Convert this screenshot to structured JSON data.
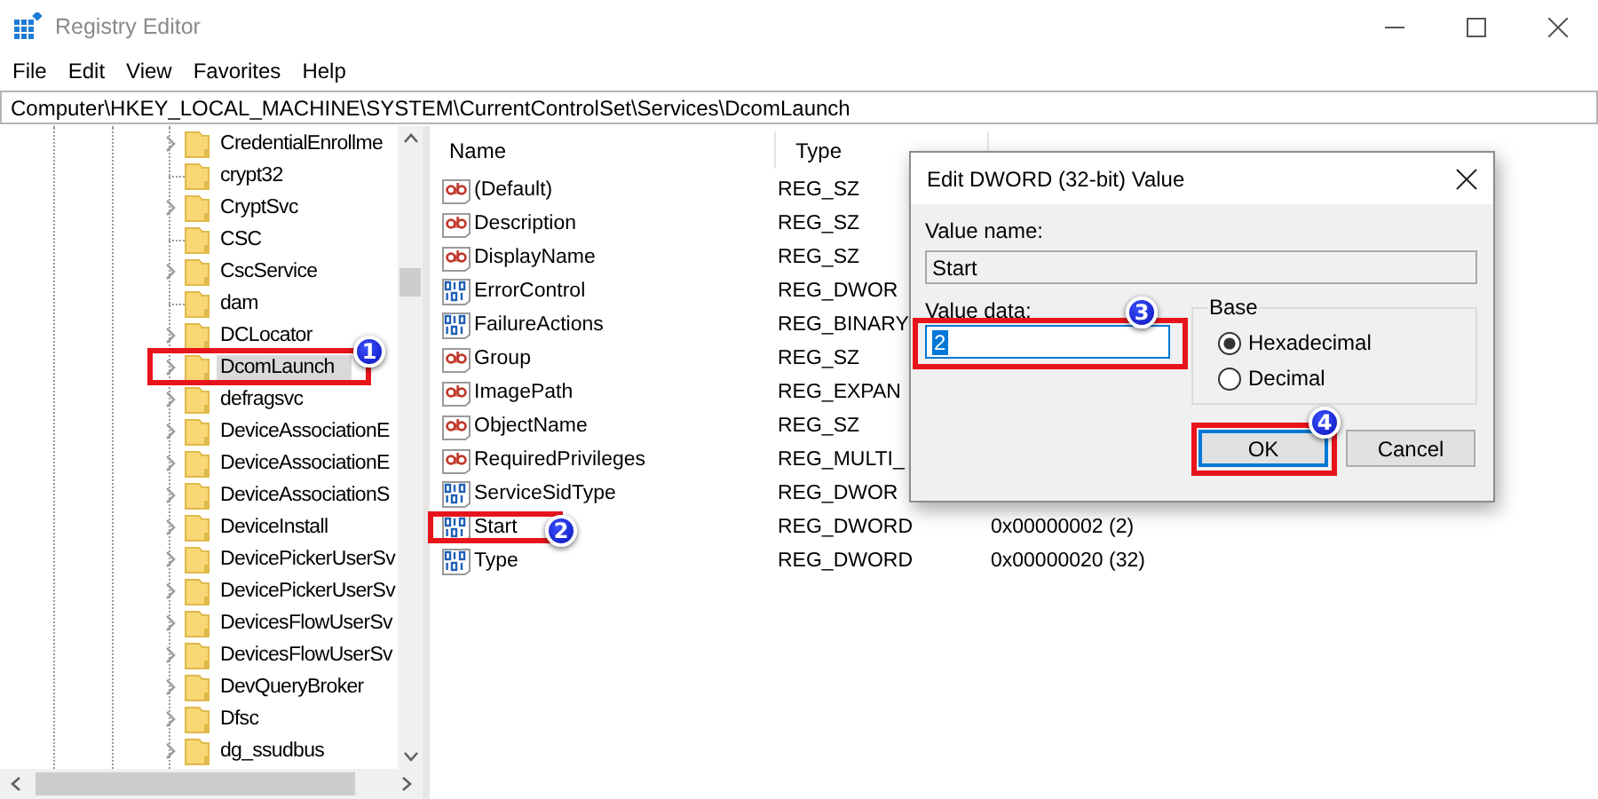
{
  "window": {
    "title": "Registry Editor"
  },
  "menu": [
    {
      "label": "File"
    },
    {
      "label": "Edit"
    },
    {
      "label": "View"
    },
    {
      "label": "Favorites"
    },
    {
      "label": "Help"
    }
  ],
  "address": "Computer\\HKEY_LOCAL_MACHINE\\SYSTEM\\CurrentControlSet\\Services\\DcomLaunch",
  "tree": {
    "items": [
      {
        "label": "CredentialEnrollme",
        "expandable": true,
        "selected": false
      },
      {
        "label": "crypt32",
        "expandable": false,
        "selected": false
      },
      {
        "label": "CryptSvc",
        "expandable": true,
        "selected": false
      },
      {
        "label": "CSC",
        "expandable": false,
        "selected": false
      },
      {
        "label": "CscService",
        "expandable": true,
        "selected": false
      },
      {
        "label": "dam",
        "expandable": false,
        "selected": false
      },
      {
        "label": "DCLocator",
        "expandable": true,
        "selected": false
      },
      {
        "label": "DcomLaunch",
        "expandable": true,
        "selected": true,
        "callout": "1"
      },
      {
        "label": "defragsvc",
        "expandable": true,
        "selected": false
      },
      {
        "label": "DeviceAssociationE",
        "expandable": true,
        "selected": false
      },
      {
        "label": "DeviceAssociationE",
        "expandable": true,
        "selected": false
      },
      {
        "label": "DeviceAssociationS",
        "expandable": true,
        "selected": false
      },
      {
        "label": "DeviceInstall",
        "expandable": true,
        "selected": false
      },
      {
        "label": "DevicePickerUserSv",
        "expandable": true,
        "selected": false
      },
      {
        "label": "DevicePickerUserSv",
        "expandable": true,
        "selected": false
      },
      {
        "label": "DevicesFlowUserSv",
        "expandable": true,
        "selected": false
      },
      {
        "label": "DevicesFlowUserSv",
        "expandable": true,
        "selected": false
      },
      {
        "label": "DevQueryBroker",
        "expandable": true,
        "selected": false
      },
      {
        "label": "Dfsc",
        "expandable": true,
        "selected": false
      },
      {
        "label": "dg_ssudbus",
        "expandable": true,
        "selected": false
      }
    ]
  },
  "values": {
    "columns": [
      "Name",
      "Type"
    ],
    "rows": [
      {
        "name": "(Default)",
        "kind": "string",
        "type": "REG_SZ"
      },
      {
        "name": "Description",
        "kind": "string",
        "type": "REG_SZ"
      },
      {
        "name": "DisplayName",
        "kind": "string",
        "type": "REG_SZ"
      },
      {
        "name": "ErrorControl",
        "kind": "dword",
        "type": "REG_DWOR"
      },
      {
        "name": "FailureActions",
        "kind": "dword",
        "type": "REG_BINARY"
      },
      {
        "name": "Group",
        "kind": "string",
        "type": "REG_SZ"
      },
      {
        "name": "ImagePath",
        "kind": "string",
        "type": "REG_EXPAN"
      },
      {
        "name": "ObjectName",
        "kind": "string",
        "type": "REG_SZ"
      },
      {
        "name": "RequiredPrivileges",
        "kind": "string",
        "type": "REG_MULTI_"
      },
      {
        "name": "ServiceSidType",
        "kind": "dword",
        "type": "REG_DWOR"
      },
      {
        "name": "Start",
        "kind": "dword",
        "type": "REG_DWORD",
        "data": "0x00000002 (2)",
        "callout": "2"
      },
      {
        "name": "Type",
        "kind": "dword",
        "type": "REG_DWORD",
        "data": "0x00000020 (32)"
      }
    ]
  },
  "dialog": {
    "title": "Edit DWORD (32-bit) Value",
    "value_name_label": "Value name:",
    "value_name": "Start",
    "value_data_label": "Value data:",
    "value_data": "2",
    "value_data_callout": "3",
    "base": {
      "label": "Base",
      "options": [
        {
          "label": "Hexadecimal",
          "selected": true
        },
        {
          "label": "Decimal",
          "selected": false
        }
      ]
    },
    "buttons": [
      {
        "label": "OK",
        "default": true,
        "callout": "4"
      },
      {
        "label": "Cancel",
        "default": false
      }
    ]
  }
}
